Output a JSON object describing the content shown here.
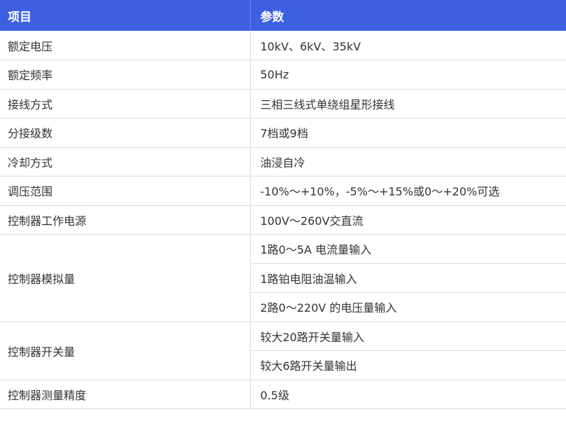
{
  "table": {
    "headers": [
      "项目",
      "参数"
    ],
    "rows": [
      {
        "item": "额定电压",
        "values": [
          "10kV、6kV、35kV"
        ]
      },
      {
        "item": "额定频率",
        "values": [
          "50Hz"
        ]
      },
      {
        "item": "接线方式",
        "values": [
          "三相三线式单绕组星形接线"
        ]
      },
      {
        "item": "分接级数",
        "values": [
          "7档或9档"
        ]
      },
      {
        "item": "冷却方式",
        "values": [
          "油浸自冷"
        ]
      },
      {
        "item": "调压范围",
        "values": [
          "-10%～+10%，-5%～+15%或0～+20%可选"
        ]
      },
      {
        "item": "控制器工作电源",
        "values": [
          "100V～260V交直流"
        ]
      },
      {
        "item": "控制器模拟量",
        "values": [
          "1路0～5A 电流量输入",
          "1路铂电阻油温输入",
          "2路0～220V 的电压量输入"
        ]
      },
      {
        "item": "控制器开关量",
        "values": [
          "较大20路开关量输入",
          "较大6路开关量输出"
        ]
      },
      {
        "item": "控制器测量精度",
        "values": [
          "0.5级"
        ]
      }
    ]
  }
}
